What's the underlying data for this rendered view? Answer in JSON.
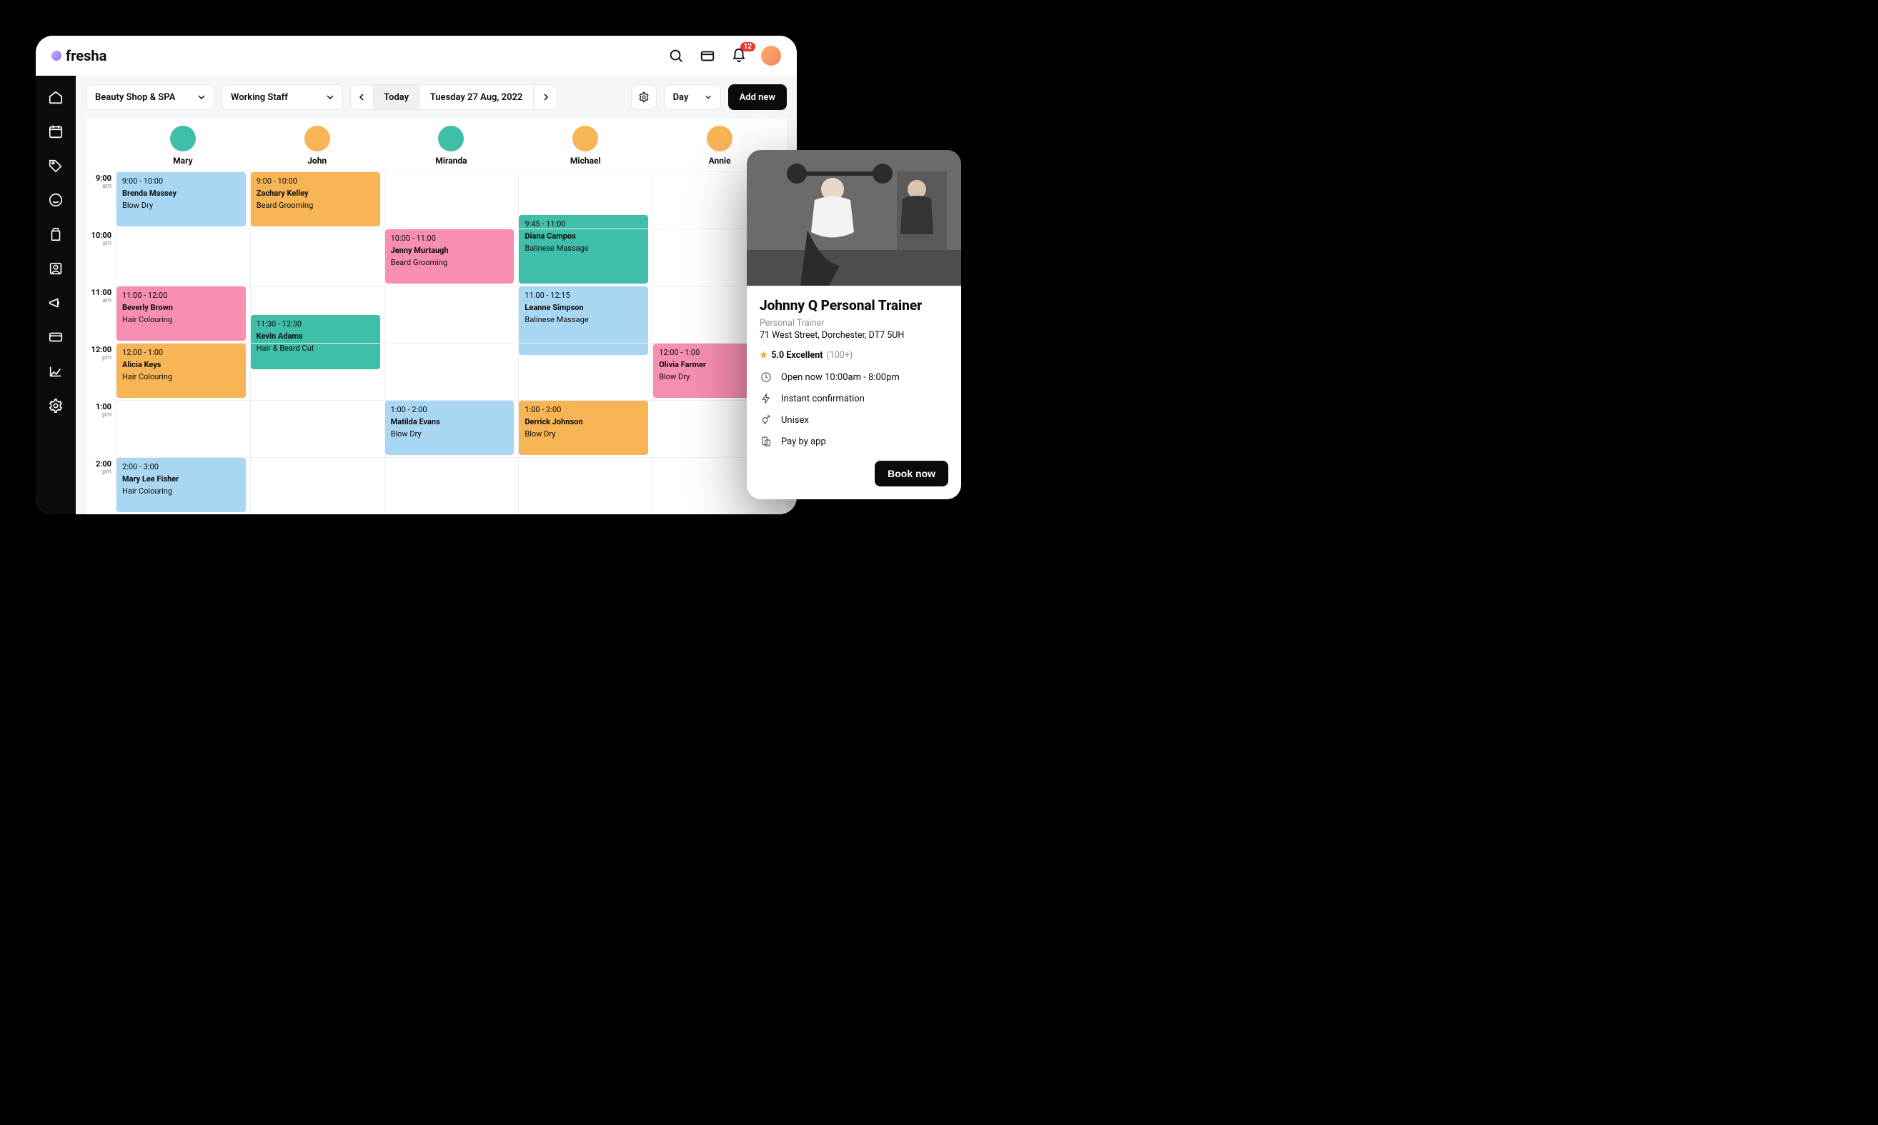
{
  "brand": "fresha",
  "notification_count": "12",
  "toolbar": {
    "location": "Beauty Shop & SPA",
    "staff_filter": "Working Staff",
    "today": "Today",
    "date": "Tuesday 27 Aug, 2022",
    "view": "Day",
    "add_new": "Add new"
  },
  "staff": [
    "Mary",
    "John",
    "Miranda",
    "Michael",
    "Annie"
  ],
  "hours": [
    {
      "h": "9:00",
      "p": "am"
    },
    {
      "h": "10:00",
      "p": "am"
    },
    {
      "h": "11:00",
      "p": "am"
    },
    {
      "h": "12:00",
      "p": "pm"
    },
    {
      "h": "1:00",
      "p": "pm"
    },
    {
      "h": "2:00",
      "p": "pm"
    }
  ],
  "events": [
    {
      "col": 0,
      "start": 9.0,
      "end": 10.0,
      "color": "c-blue",
      "time": "9:00 - 10:00",
      "name": "Brenda Massey",
      "svc": "Blow Dry"
    },
    {
      "col": 1,
      "start": 9.0,
      "end": 10.0,
      "color": "c-orange",
      "time": "9:00 - 10:00",
      "name": "Zachary Kelley",
      "svc": "Beard Grooming"
    },
    {
      "col": 2,
      "start": 10.0,
      "end": 11.0,
      "color": "c-pink",
      "time": "10:00 - 11:00",
      "name": "Jenny Murtaugh",
      "svc": "Beard Grooming"
    },
    {
      "col": 3,
      "start": 9.75,
      "end": 11.0,
      "color": "c-teal",
      "time": "9:45 - 11:00",
      "name": "Diana Campos",
      "svc": "Balinese Massage"
    },
    {
      "col": 0,
      "start": 11.0,
      "end": 12.0,
      "color": "c-pink",
      "time": "11:00 - 12:00",
      "name": "Beverly Brown",
      "svc": "Hair Colouring"
    },
    {
      "col": 3,
      "start": 11.0,
      "end": 12.25,
      "color": "c-blue",
      "time": "11:00 - 12:15",
      "name": "Leanne Simpson",
      "svc": "Balinese Massage"
    },
    {
      "col": 1,
      "start": 11.5,
      "end": 12.5,
      "color": "c-teal",
      "time": "11:30 - 12:30",
      "name": "Kevin Adams",
      "svc": "Hair & Beard Cut"
    },
    {
      "col": 0,
      "start": 12.0,
      "end": 13.0,
      "color": "c-orange",
      "time": "12:00 - 1:00",
      "name": "Alicia Keys",
      "svc": "Hair Colouring"
    },
    {
      "col": 4,
      "start": 12.0,
      "end": 13.0,
      "color": "c-pink",
      "time": "12:00 - 1:00",
      "name": "Olivia Farmer",
      "svc": "Blow Dry"
    },
    {
      "col": 2,
      "start": 13.0,
      "end": 14.0,
      "color": "c-blue",
      "time": "1:00 - 2:00",
      "name": "Matilda Evans",
      "svc": "Blow Dry"
    },
    {
      "col": 3,
      "start": 13.0,
      "end": 14.0,
      "color": "c-orange",
      "time": "1:00 - 2:00",
      "name": "Derrick Johnson",
      "svc": "Blow Dry"
    },
    {
      "col": 0,
      "start": 14.0,
      "end": 15.0,
      "color": "c-blue",
      "time": "2:00 - 3:00",
      "name": "Mary Lee Fisher",
      "svc": "Hair Colouring"
    }
  ],
  "popup": {
    "title": "Johnny Q Personal Trainer",
    "subtitle": "Personal Trainer",
    "address": "71 West Street, Dorchester, DT7 5UH",
    "rating_score": "5.0 Excellent",
    "rating_count": "(100+)",
    "features": {
      "hours": "Open now 10:00am - 8:00pm",
      "instant": "Instant confirmation",
      "unisex": "Unisex",
      "pay": "Pay by app"
    },
    "book": "Book now"
  }
}
